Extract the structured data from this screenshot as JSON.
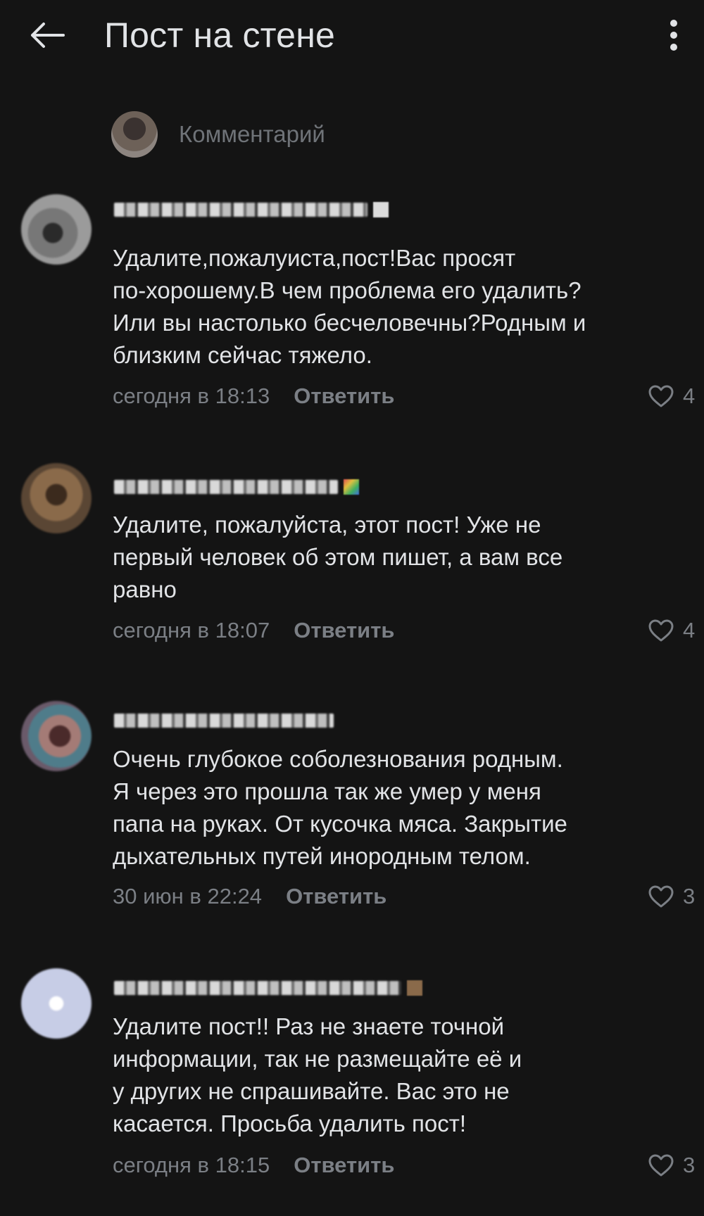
{
  "header": {
    "title": "Пост на стене",
    "back_icon": "arrow-left-icon",
    "more_icon": "more-vertical-icon"
  },
  "composer": {
    "placeholder": "Комментарий"
  },
  "comments": [
    {
      "text": "Удалите,пожалуиста,пост!Вас просят\nпо-хорошему.В чем проблема его удалить?\nИли вы настолько бесчеловечны?Родным и\nблизким сейчас тяжело.",
      "time": "сегодня в 18:13",
      "reply": "Ответить",
      "likes": "4"
    },
    {
      "text": "Удалите, пожалуйста, этот пост! Уже не\nпервый человек об этом пишет, а вам все\nравно",
      "time": "сегодня в 18:07",
      "reply": "Ответить",
      "likes": "4"
    },
    {
      "text": "Очень глубокое соболезнования родным.\nЯ через это прошла так же умер у меня\nпапа на руках. От кусочка мяса. Закрытие\nдыхательных путей инородным телом.",
      "time": "30 июн в 22:24",
      "reply": "Ответить",
      "likes": "3"
    },
    {
      "text": "Удалите пост!! Раз не знаете точной\nинформации, так не размещайте её и\nу других не спрашивайте. Вас это не\nкасается. Просьба удалить пост!",
      "time": "сегодня в 18:15",
      "reply": "Ответить",
      "likes": "3"
    }
  ],
  "colors": {
    "background": "#141414",
    "text": "#e1e3e6",
    "secondary": "#7b7f85"
  }
}
